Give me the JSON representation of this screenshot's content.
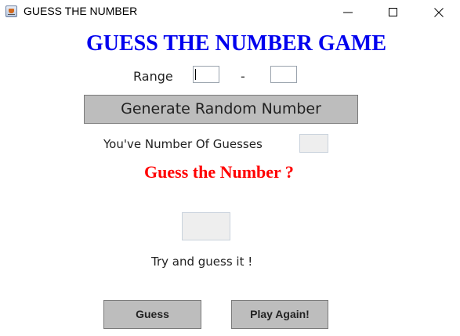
{
  "window": {
    "title": "GUESS THE NUMBER",
    "icon": "java-coffee-cup-icon",
    "controls": [
      "minimize-icon",
      "maximize-icon",
      "close-icon"
    ]
  },
  "game": {
    "heading": "GUESS THE NUMBER GAME",
    "range_label": "Range",
    "range_separator": "-",
    "range_from_value": "",
    "range_to_value": "",
    "generate_button_label": "Generate Random Number",
    "guesses_label": "You've Number Of Guesses",
    "guesses_value": "",
    "prompt": "Guess the Number ?",
    "guess_value": "",
    "hint": "Try and guess it !",
    "guess_button_label": "Guess",
    "play_again_button_label": "Play Again!"
  },
  "colors": {
    "heading": "#0000ee",
    "prompt": "#ff0000",
    "button_bg": "#bdbdbd",
    "field_bg": "#eeeeee"
  }
}
